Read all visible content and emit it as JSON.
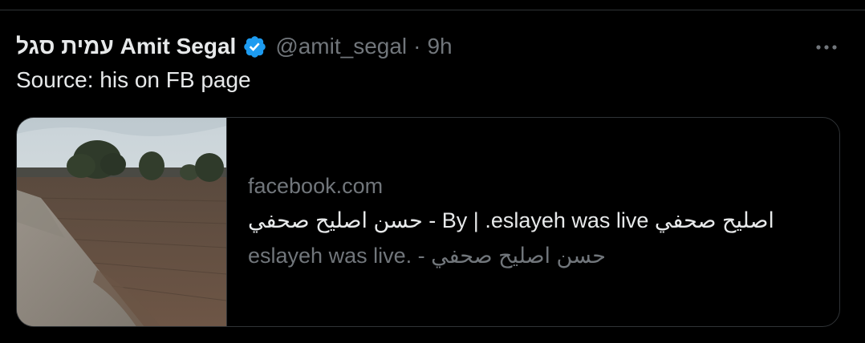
{
  "tweet": {
    "display_name": "עמית סגל Amit Segal",
    "handle": "@amit_segal",
    "separator": "·",
    "time": "9h",
    "text": "Source: his on FB page",
    "verified_icon": "verified-badge-icon",
    "more_icon": "more-horizontal-icon"
  },
  "card": {
    "domain": "facebook.com",
    "title": "اصليح صحفي By | .eslayeh was live - حسن اصليح صحفي",
    "description": "eslayeh was live. - حسن اصليح صحفي",
    "image": "field-landscape-thumbnail"
  },
  "colors": {
    "background": "#000000",
    "primary_text": "#e7e9ea",
    "secondary_text": "#71767b",
    "border": "#2f3336",
    "verified": "#1d9bf0"
  }
}
